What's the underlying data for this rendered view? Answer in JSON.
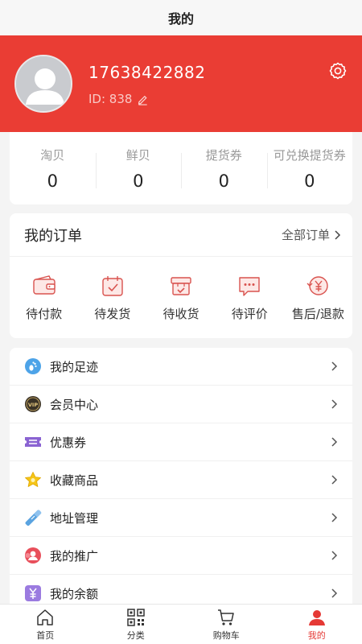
{
  "header": {
    "title": "我的"
  },
  "profile": {
    "phone": "17638422882",
    "id_text": "ID: 838"
  },
  "assets": [
    {
      "label": "淘贝",
      "value": "0"
    },
    {
      "label": "鲜贝",
      "value": "0"
    },
    {
      "label": "提货券",
      "value": "0"
    },
    {
      "label": "可兑换提货券",
      "value": "0"
    }
  ],
  "orders": {
    "title": "我的订单",
    "all_label": "全部订单",
    "items": [
      {
        "label": "待付款",
        "icon": "wallet-icon"
      },
      {
        "label": "待发货",
        "icon": "calendar-check-icon"
      },
      {
        "label": "待收货",
        "icon": "box-check-icon"
      },
      {
        "label": "待评价",
        "icon": "chat-bubble-icon"
      },
      {
        "label": "售后/退款",
        "icon": "refund-yen-icon"
      }
    ]
  },
  "menu": [
    {
      "label": "我的足迹",
      "icon": "footprint-icon"
    },
    {
      "label": "会员中心",
      "icon": "vip-badge-icon"
    },
    {
      "label": "优惠券",
      "icon": "coupon-icon"
    },
    {
      "label": "收藏商品",
      "icon": "star-icon"
    },
    {
      "label": "地址管理",
      "icon": "address-icon"
    },
    {
      "label": "我的推广",
      "icon": "promotion-icon"
    },
    {
      "label": "我的余额",
      "icon": "balance-yen-icon"
    }
  ],
  "tabbar": [
    {
      "label": "首页",
      "icon": "home-icon",
      "active": false
    },
    {
      "label": "分类",
      "icon": "qr-grid-icon",
      "active": false
    },
    {
      "label": "购物车",
      "icon": "cart-icon",
      "active": false
    },
    {
      "label": "我的",
      "icon": "user-icon",
      "active": true
    }
  ],
  "colors": {
    "brand_red": "#ea3d34",
    "tab_active": "#e53935"
  }
}
